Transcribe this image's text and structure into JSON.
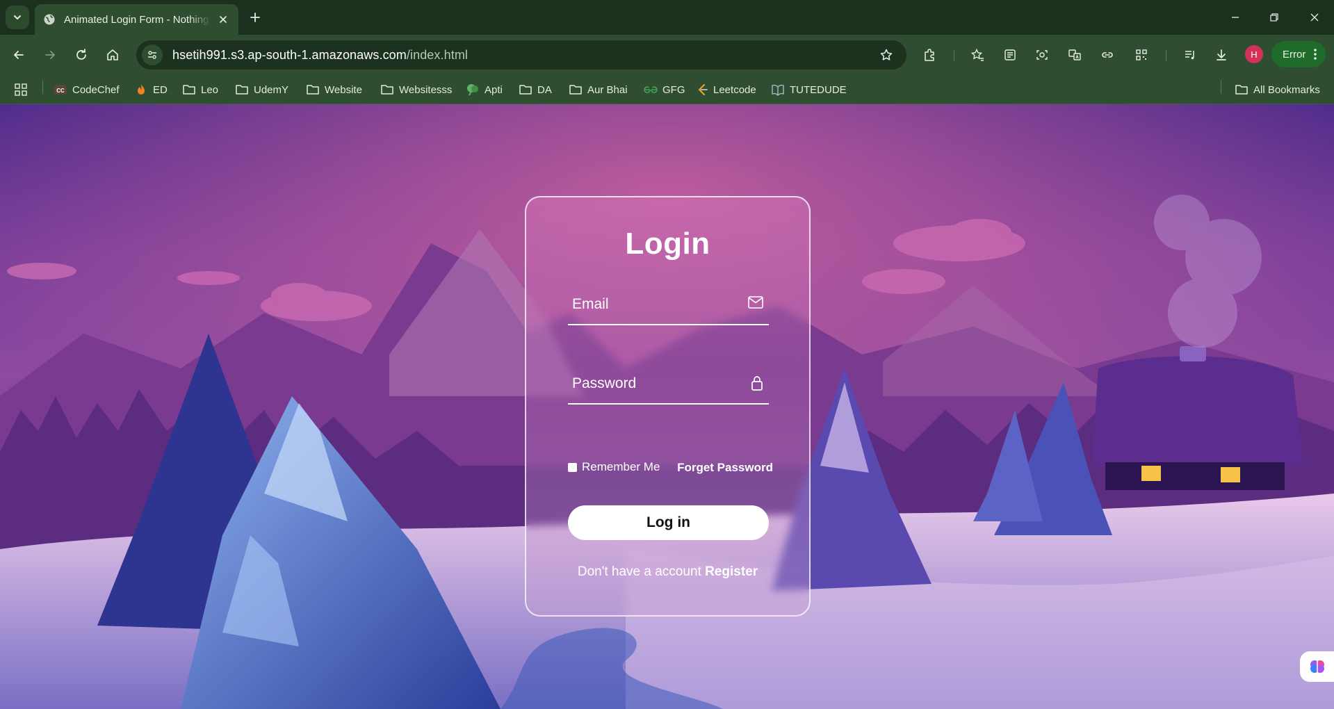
{
  "browser": {
    "tab_title": "Animated Login Form - Nothing",
    "url_host": "hsetih991.s3.ap-south-1.amazonaws.com",
    "url_path": "/index.html",
    "profile_initial": "H",
    "error_label": "Error"
  },
  "bookmarks": [
    {
      "label": "CodeChef",
      "icon": "codechef-icon"
    },
    {
      "label": "ED",
      "icon": "fire-icon"
    },
    {
      "label": "Leo",
      "icon": "folder-icon"
    },
    {
      "label": "UdemY",
      "icon": "folder-icon"
    },
    {
      "label": "Website",
      "icon": "folder-icon"
    },
    {
      "label": "Websitesss",
      "icon": "folder-icon"
    },
    {
      "label": "Apti",
      "icon": "brain-icon"
    },
    {
      "label": "DA",
      "icon": "folder-icon"
    },
    {
      "label": "Aur Bhai",
      "icon": "folder-icon"
    },
    {
      "label": "GFG",
      "icon": "gfg-icon"
    },
    {
      "label": "Leetcode",
      "icon": "leetcode-icon"
    },
    {
      "label": "TUTEDUDE",
      "icon": "book-icon"
    }
  ],
  "all_bookmarks_label": "All Bookmarks",
  "login": {
    "title": "Login",
    "email_placeholder": "Email",
    "password_placeholder": "Password",
    "remember_label": "Remember Me",
    "forgot_label": "Forget Password",
    "button_label": "Log in",
    "no_account_text": "Don't have a account",
    "register_label": "Register"
  },
  "colors": {
    "chrome_dark": "#1b301d",
    "chrome": "#2f4d31",
    "sky_top": "#4a2a8a",
    "sky_mid": "#8d4a9f",
    "accent_error": "#1f6b2a"
  }
}
